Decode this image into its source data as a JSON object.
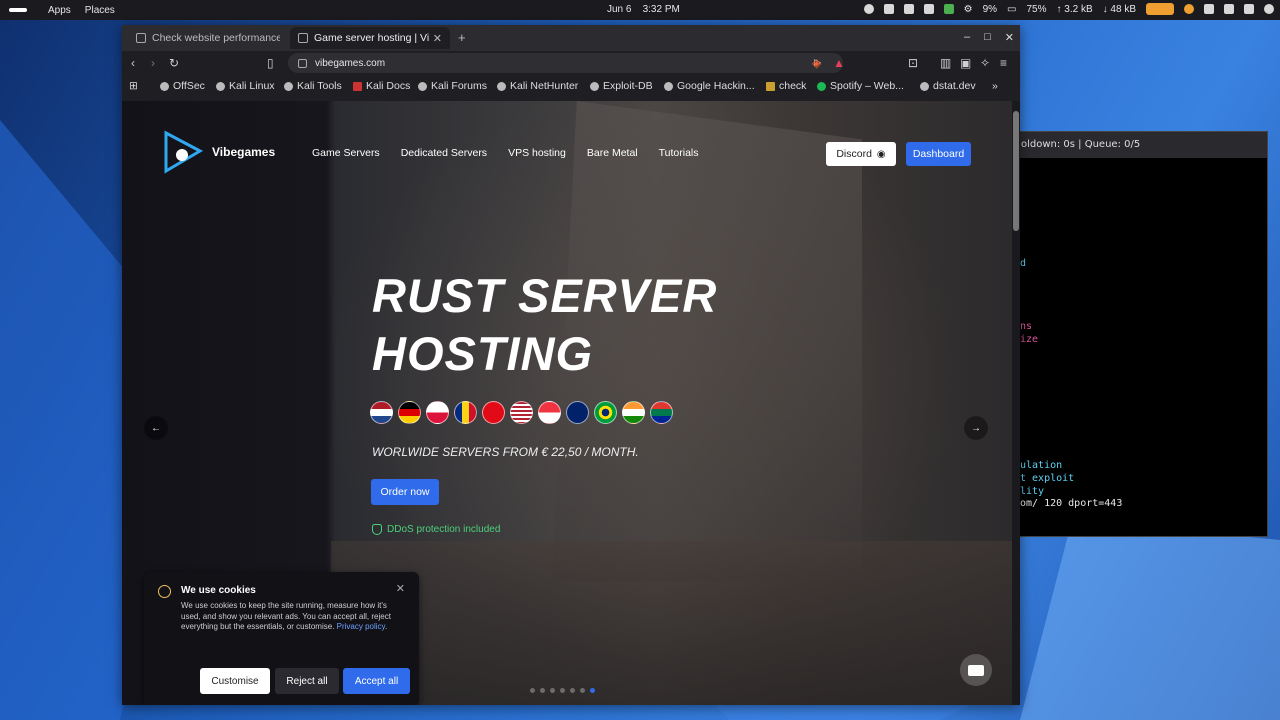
{
  "topbar": {
    "apps": "Apps",
    "places": "Places",
    "date": "Jun 6",
    "time": "3:32 PM",
    "cpu": "9%",
    "memory": "75%",
    "net_up": "↑ 3.2 kB",
    "net_down": "↓ 48 kB"
  },
  "terminal": {
    "title": "oldown: 0s | Queue: 0/5",
    "lines": [
      "d",
      "ns",
      "ize",
      "ulation",
      "t exploit",
      "lity",
      "om/ 120 dport=443"
    ]
  },
  "browser": {
    "tabs": [
      {
        "title": "Check website performance a"
      },
      {
        "title": "Game server hosting | Vib"
      }
    ],
    "url": "vibegames.com",
    "bookmarks": [
      "OffSec",
      "Kali Linux",
      "Kali Tools",
      "Kali Docs",
      "Kali Forums",
      "Kali NetHunter",
      "Exploit-DB",
      "Google Hackin...",
      "check",
      "Spotify – Web...",
      "dstat.dev"
    ]
  },
  "site": {
    "brand": "Vibegames",
    "nav": [
      "Game Servers",
      "Dedicated Servers",
      "VPS hosting",
      "Bare Metal",
      "Tutorials"
    ],
    "discord_label": "Discord",
    "dashboard_label": "Dashboard",
    "hero_line1": "RUST SERVER",
    "hero_line2": "HOSTING",
    "subline": "WORLWIDE SERVERS FROM € 22,50 / MONTH.",
    "order_label": "Order now",
    "ddos_text": "DDoS protection included",
    "prev_arrow": "←",
    "next_arrow": "→",
    "active_slide": 6,
    "slide_count": 7
  },
  "cookie": {
    "title": "We use cookies",
    "body": "We use cookies to keep the site running, measure how it's used, and show you relevant ads. You can accept all, reject everything but the essentials, or customise.",
    "link": "Privacy policy",
    "customise": "Customise",
    "reject": "Reject all",
    "accept": "Accept all"
  },
  "colors": {
    "accent": "#2f6bea",
    "ddos_green": "#4cd07a"
  }
}
